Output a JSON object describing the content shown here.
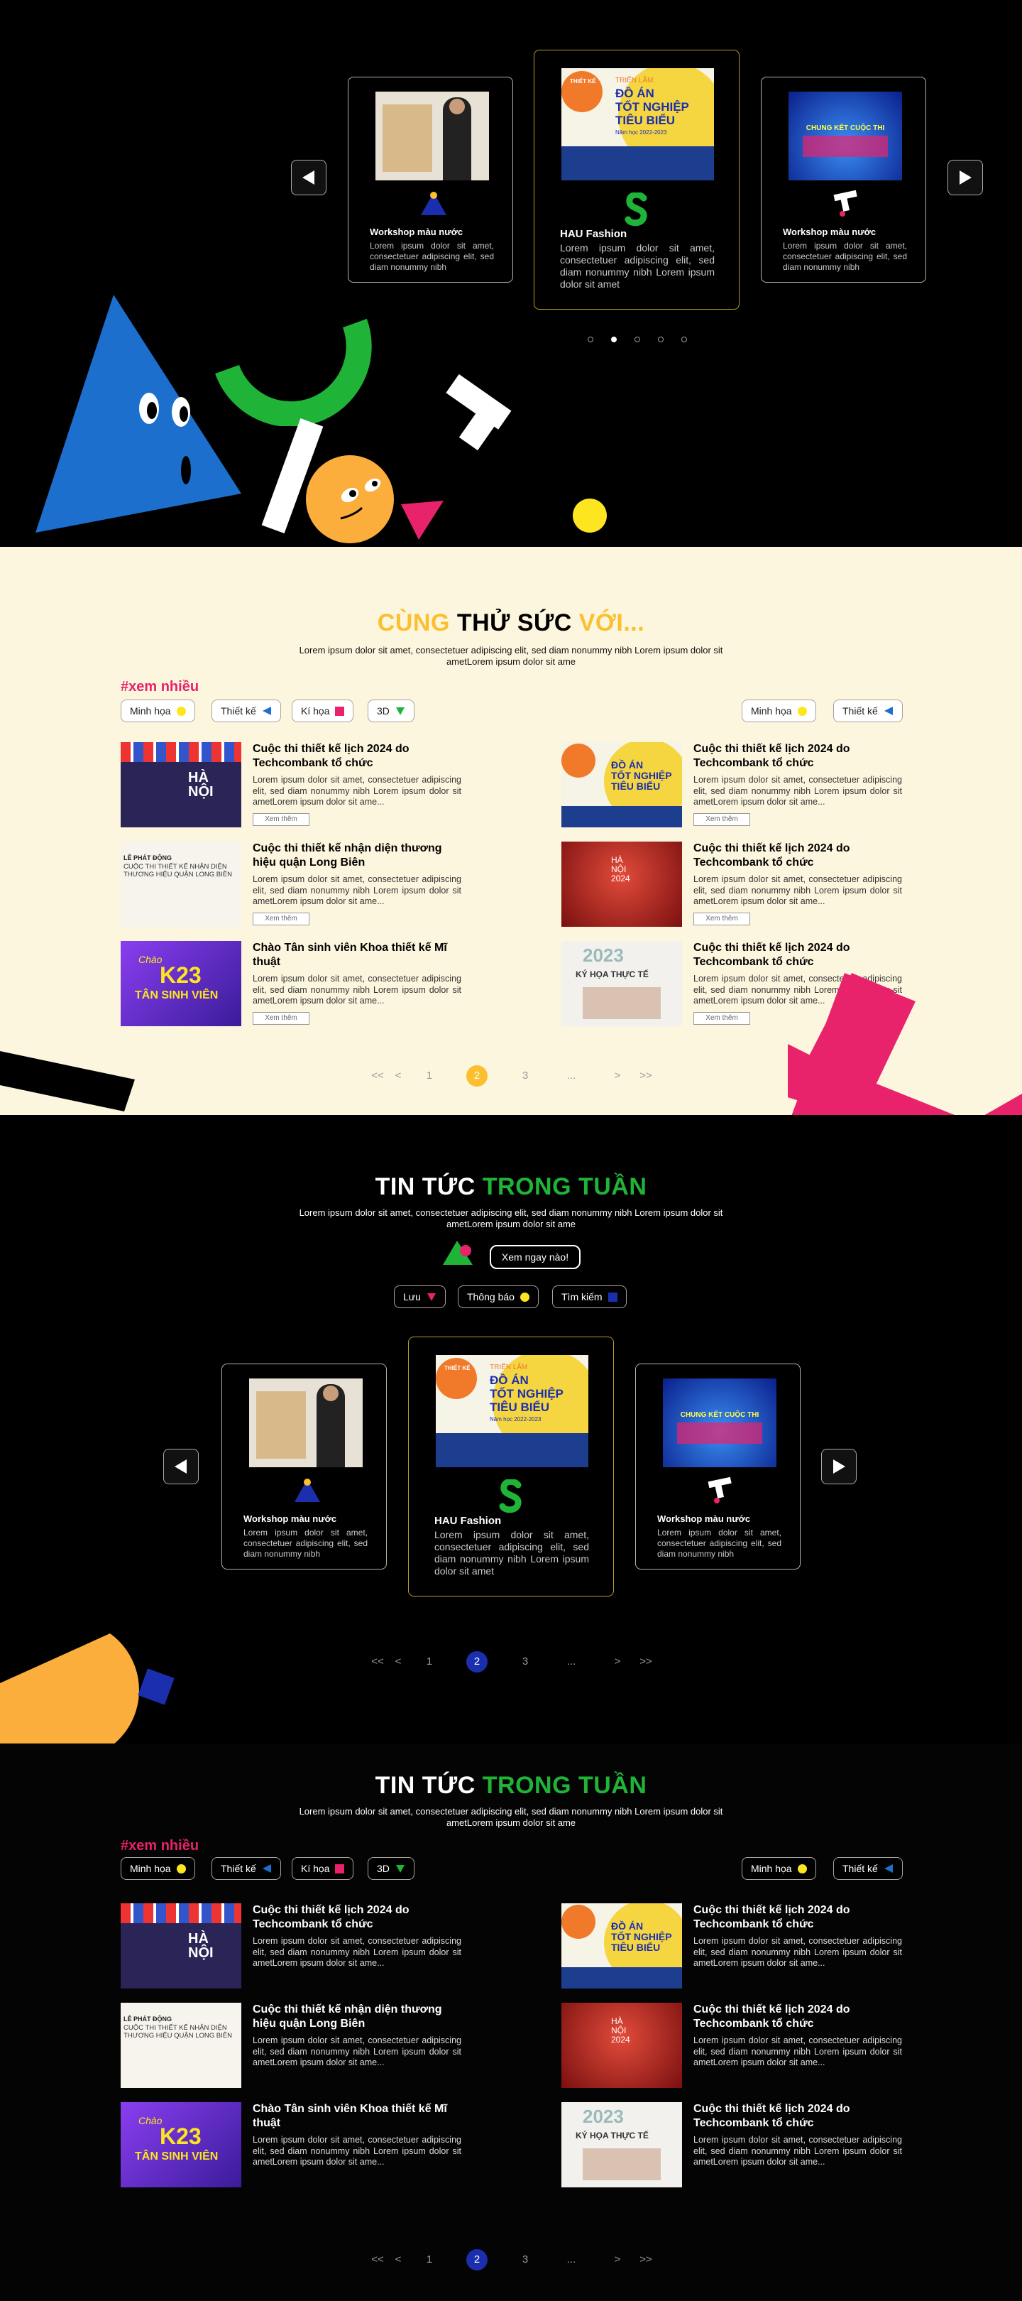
{
  "colors": {
    "yellow": "#fbbf30",
    "green": "#1fb438",
    "pink": "#e8226b",
    "blue": "#1d6fce",
    "darkblue": "#1b2fae",
    "cream": "#fdf6de"
  },
  "carousel": {
    "left": {
      "title": "Workshop màu nước",
      "desc": "Lorem ipsum dolor sit amet, consectetuer adipiscing elit, sed diam nonummy nibh"
    },
    "center": {
      "title": "HAU Fashion",
      "desc": "Lorem ipsum dolor sit amet, consectetuer adipiscing elit, sed diam nonummy nibh Lorem ipsum dolor sit amet",
      "poster": {
        "tag": "THIẾT KẾ",
        "l1": "TRIỂN LÃM",
        "l2": "ĐỒ ÁN",
        "l3": "TỐT NGHIỆP",
        "l4": "TIÊU BIỂU",
        "l5": "Năm học 2022-2023"
      }
    },
    "right": {
      "title": "Workshop màu nước",
      "desc": "Lorem ipsum dolor sit amet, consectetuer adipiscing elit, sed diam nonummy nibh",
      "poster": {
        "l1": "CHUNG KẾT CUỘC THI"
      }
    },
    "prev_icon": "triangle-left-icon",
    "next_icon": "triangle-right-icon"
  },
  "challenge": {
    "title_a": "CÙNG",
    "title_b": "THỬ SỨC",
    "title_c": "VỚI...",
    "subtitle": "Lorem ipsum dolor sit amet, consectetuer adipiscing elit, sed diam nonummy nibh Lorem ipsum dolor sit ametLorem ipsum dolor sit ame",
    "hashtag": "#xem nhiều",
    "chips": [
      "Minh họa",
      "Thiết kế",
      "Kí họa",
      "3D"
    ],
    "chips_right": [
      "Minh họa",
      "Thiết kế"
    ],
    "items": [
      {
        "title": "Cuộc thi thiết kế lịch 2024 do Techcombank tổ chức",
        "desc": "Lorem ipsum dolor sit amet, consectetuer adipiscing elit, sed diam nonummy nibh Lorem ipsum dolor sit ametLorem ipsum dolor sit ame...",
        "more": "Xem thêm"
      },
      {
        "title": "Cuộc thi thiết kế lịch 2024 do Techcombank tổ chức",
        "desc": "Lorem ipsum dolor sit amet, consectetuer adipiscing elit, sed diam nonummy nibh Lorem ipsum dolor sit ametLorem ipsum dolor sit ame...",
        "more": "Xem thêm"
      },
      {
        "title": "Cuộc thi thiết kế nhận diện thương hiệu quận Long Biên",
        "desc": "Lorem ipsum dolor sit amet, consectetuer adipiscing elit, sed diam nonummy nibh Lorem ipsum dolor sit ametLorem ipsum dolor sit ame...",
        "more": "Xem thêm"
      },
      {
        "title": "Cuộc thi thiết kế lịch 2024 do Techcombank tổ chức",
        "desc": "Lorem ipsum dolor sit amet, consectetuer adipiscing elit, sed diam nonummy nibh Lorem ipsum dolor sit ametLorem ipsum dolor sit ame...",
        "more": "Xem thêm"
      },
      {
        "title": "Chào Tân sinh viên Khoa thiết kế Mĩ thuật",
        "desc": "Lorem ipsum dolor sit amet, consectetuer adipiscing elit, sed diam nonummy nibh Lorem ipsum dolor sit ametLorem ipsum dolor sit ame...",
        "more": "Xem thêm"
      },
      {
        "title": "Cuộc thi thiết kế lịch 2024 do Techcombank tổ chức",
        "desc": "Lorem ipsum dolor sit amet, consectetuer adipiscing elit, sed diam nonummy nibh Lorem ipsum dolor sit ametLorem ipsum dolor sit ame...",
        "more": "Xem thêm"
      }
    ],
    "pager": [
      "<<",
      "<",
      "1",
      "2",
      "3",
      "...",
      ">",
      ">>"
    ]
  },
  "news": {
    "title_a": "TIN TỨC",
    "title_b": "TRONG TUẦN",
    "subtitle": "Lorem ipsum dolor sit amet, consectetuer adipiscing elit, sed diam nonummy nibh Lorem ipsum dolor sit ametLorem ipsum dolor sit ame",
    "cta": "Xem ngay nào!",
    "chips": [
      "Lưu",
      "Thông báo",
      "Tìm kiếm"
    ],
    "left": {
      "title": "Workshop màu nước",
      "desc": "Lorem ipsum dolor sit amet, consectetuer adipiscing elit, sed diam nonummy nibh"
    },
    "center": {
      "title": "HAU Fashion",
      "desc": "Lorem ipsum dolor sit amet, consectetuer adipiscing elit, sed diam nonummy nibh Lorem ipsum dolor sit amet"
    },
    "right": {
      "title": "Workshop màu nước",
      "desc": "Lorem ipsum dolor sit amet, consectetuer adipiscing elit, sed diam nonummy nibh"
    }
  },
  "news2": {
    "title_a": "TIN TỨC",
    "title_b": "TRONG TUẦN",
    "subtitle": "Lorem ipsum dolor sit amet, consectetuer adipiscing elit, sed diam nonummy nibh Lorem ipsum dolor sit ametLorem ipsum dolor sit ame",
    "hashtag": "#xem nhiều",
    "chips": [
      "Minh họa",
      "Thiết kế",
      "Kí họa",
      "3D"
    ],
    "chips_right": [
      "Minh họa",
      "Thiết kế"
    ]
  },
  "posters": {
    "k23_a": "Chào",
    "k23_b": "K23",
    "k23_c": "TÂN SINH VIÊN",
    "kyhoa": "KÝ HỌA THỰC TẾ",
    "year": "2023",
    "longbien": "CUỘC THI THIẾT KẾ NHẬN DIỆN THƯƠNG HIỆU QUẬN LONG BIÊN",
    "ld": "LỄ PHÁT ĐỘNG"
  }
}
